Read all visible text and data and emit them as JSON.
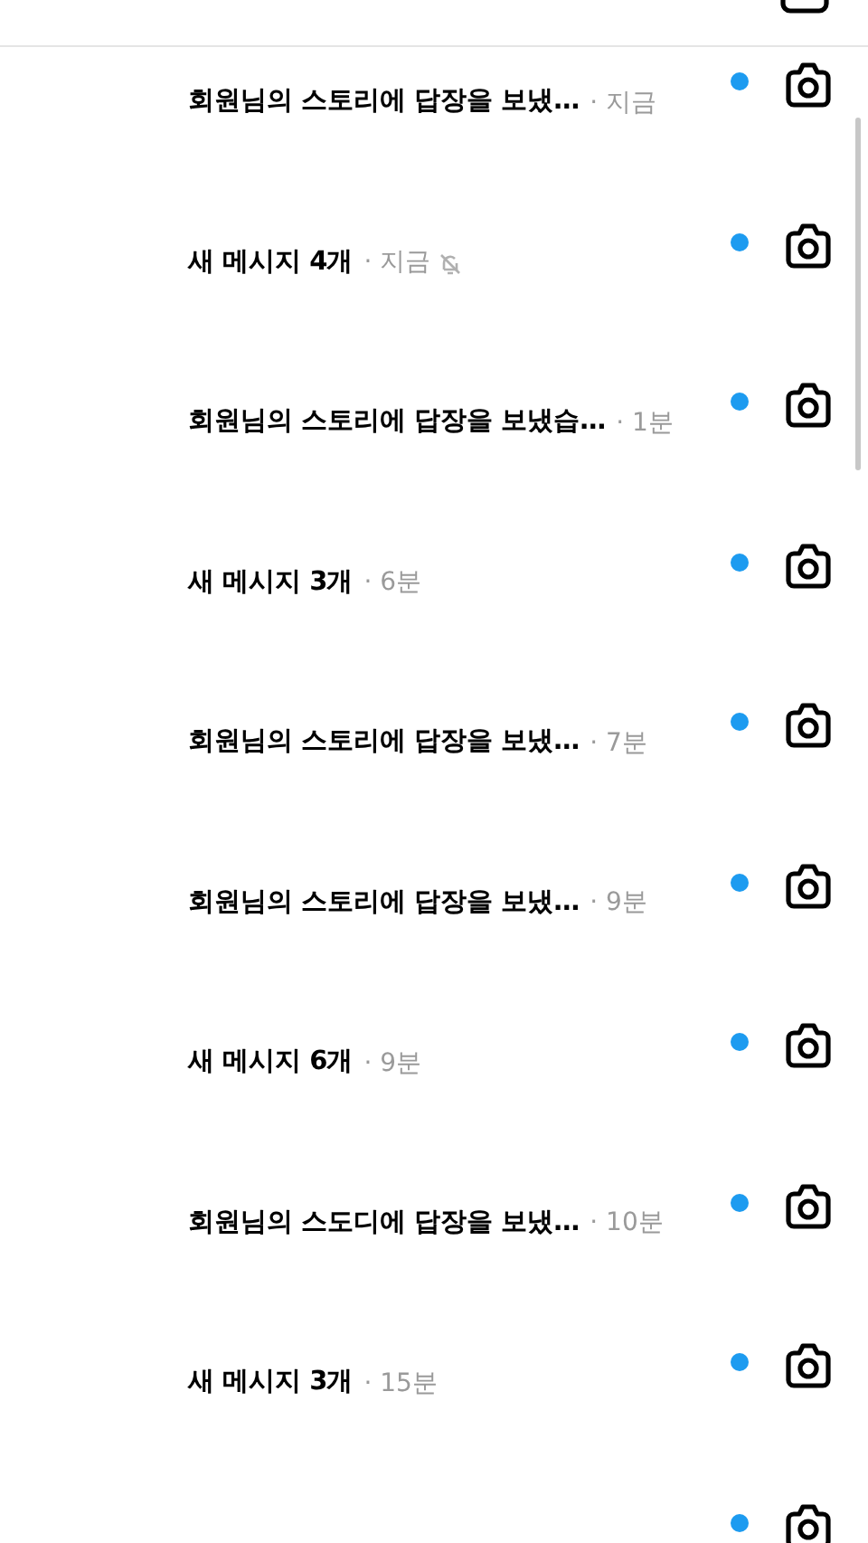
{
  "threads": [
    {
      "message": "회원님의 스토리에 답장을 보냈…",
      "time": "· 지금",
      "muted": false,
      "unread": true
    },
    {
      "message": "새 메시지 4개",
      "time": "· 지금",
      "muted": true,
      "unread": true
    },
    {
      "message": "회원님의 스토리에 답장을 보냈습…",
      "time": "· 1분",
      "muted": false,
      "unread": true
    },
    {
      "message": "새 메시지 3개",
      "time": "· 6분",
      "muted": false,
      "unread": true
    },
    {
      "message": "회원님의 스토리에 답장을 보냈…",
      "time": "· 7분",
      "muted": false,
      "unread": true
    },
    {
      "message": "회원님의 스토리에 답장을 보냈…",
      "time": "· 9분",
      "muted": false,
      "unread": true
    },
    {
      "message": "새 메시지 6개",
      "time": "· 9분",
      "muted": false,
      "unread": true
    },
    {
      "message": "회원님의 스도디에 답장을 보냈…",
      "time": "· 10분",
      "muted": false,
      "unread": true
    },
    {
      "message": "새 메시지 3개",
      "time": "· 15분",
      "muted": false,
      "unread": true
    },
    {
      "muted": false,
      "unread": true
    }
  ]
}
